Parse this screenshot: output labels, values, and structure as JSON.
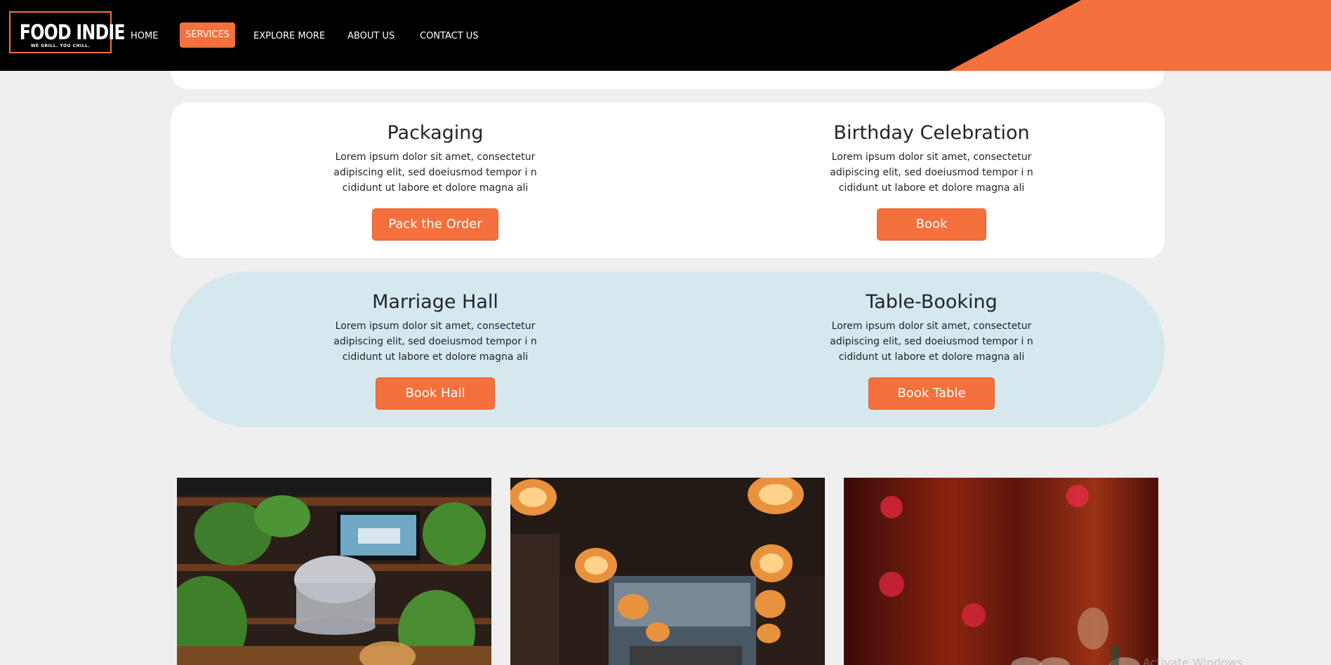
{
  "brand": {
    "name": "FOOD INDIE",
    "tagline": "WE GRILL. YOU CHILL.",
    "accent_color": "#f4703c",
    "header_bg": "#000000"
  },
  "nav": {
    "items": [
      {
        "label": "HOME",
        "active": false
      },
      {
        "label": "SERVICES",
        "active": true
      },
      {
        "label": "EXPLORE MORE",
        "active": false
      },
      {
        "label": "ABOUT US",
        "active": false
      },
      {
        "label": "CONTACT US",
        "active": false
      }
    ]
  },
  "services": {
    "row1": {
      "background": "#ffffff",
      "left": {
        "title": "Packaging",
        "text": "Lorem ipsum dolor sit amet, consectetur adipiscing elit, sed doeiusmod tempor i ncididunt ut labore et dolore magna ali",
        "button": "Pack the Order"
      },
      "right": {
        "title": "Birthday Celebration",
        "text": "Lorem ipsum dolor sit amet, consectetur adipiscing elit, sed doeiusmod tempor i ncididunt ut labore et dolore magna ali",
        "button": "Book"
      }
    },
    "row2": {
      "background": "#d5e8ee",
      "left": {
        "title": "Marriage Hall",
        "text": "Lorem ipsum dolor sit amet, consectetur adipiscing elit, sed doeiusmod tempor i ncididunt ut labore et dolore magna ali",
        "button": "Book Hall"
      },
      "right": {
        "title": "Table-Booking",
        "text": "Lorem ipsum dolor sit amet, consectetur adipiscing elit, sed doeiusmod tempor i ncididunt ut labore et dolore magna ali",
        "button": "Book Table"
      }
    }
  },
  "gallery": {
    "images": [
      {
        "name": "restaurant-plants-interior-photo"
      },
      {
        "name": "pendant-lamps-dining-photo"
      },
      {
        "name": "red-curtain-wine-glasses-photo"
      }
    ]
  },
  "os_watermark": "Activate Windows"
}
